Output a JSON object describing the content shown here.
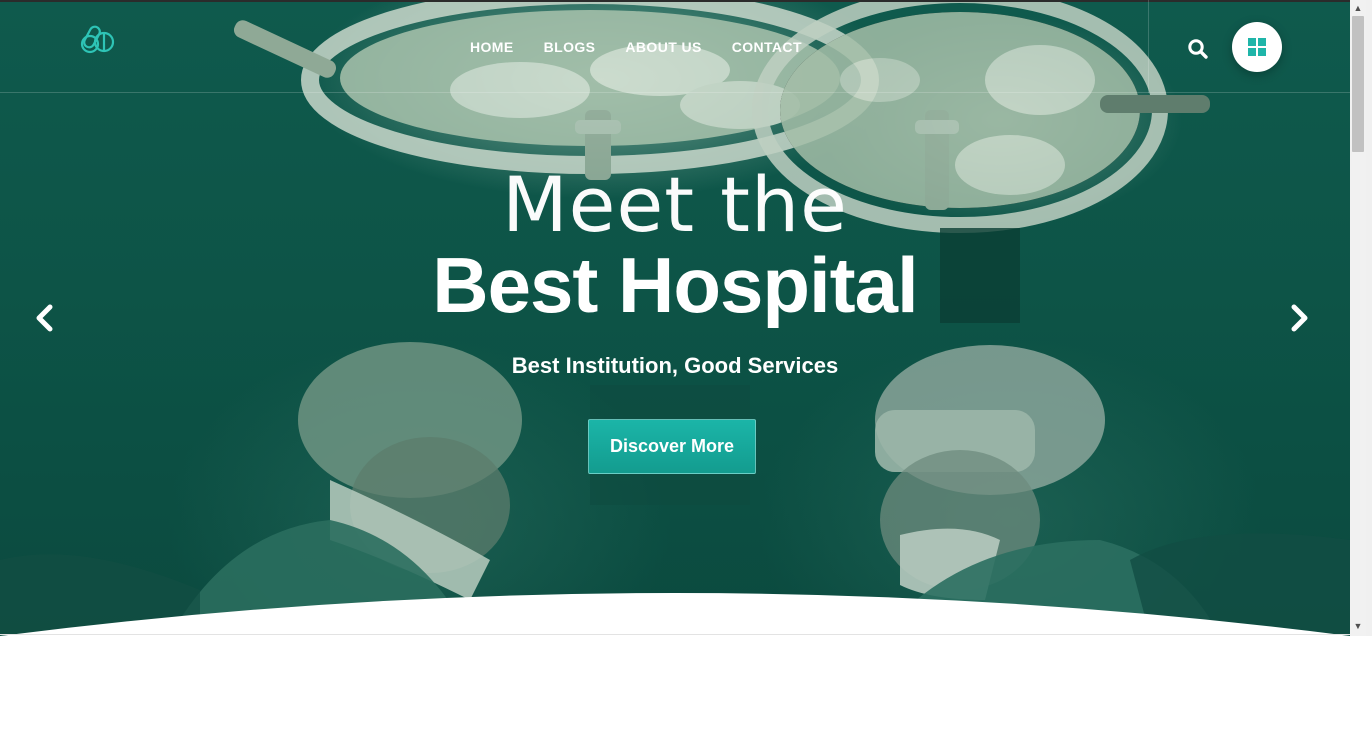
{
  "nav": {
    "items": [
      {
        "label": "HOME"
      },
      {
        "label": "BLOGS"
      },
      {
        "label": "ABOUT US"
      },
      {
        "label": "CONTACT"
      }
    ]
  },
  "hero": {
    "headline_light": "Meet the",
    "headline_bold": "Best Hospital",
    "subtitle": "Best Institution, Good Services",
    "cta_label": "Discover More"
  },
  "icons": {
    "logo": "pill-capsule-logo-icon",
    "search": "search-icon",
    "menu": "grid-menu-icon",
    "prev": "chevron-left-icon",
    "next": "chevron-right-icon"
  },
  "colors": {
    "accent": "#19b2a6",
    "hero_overlay": "#0d5447"
  }
}
